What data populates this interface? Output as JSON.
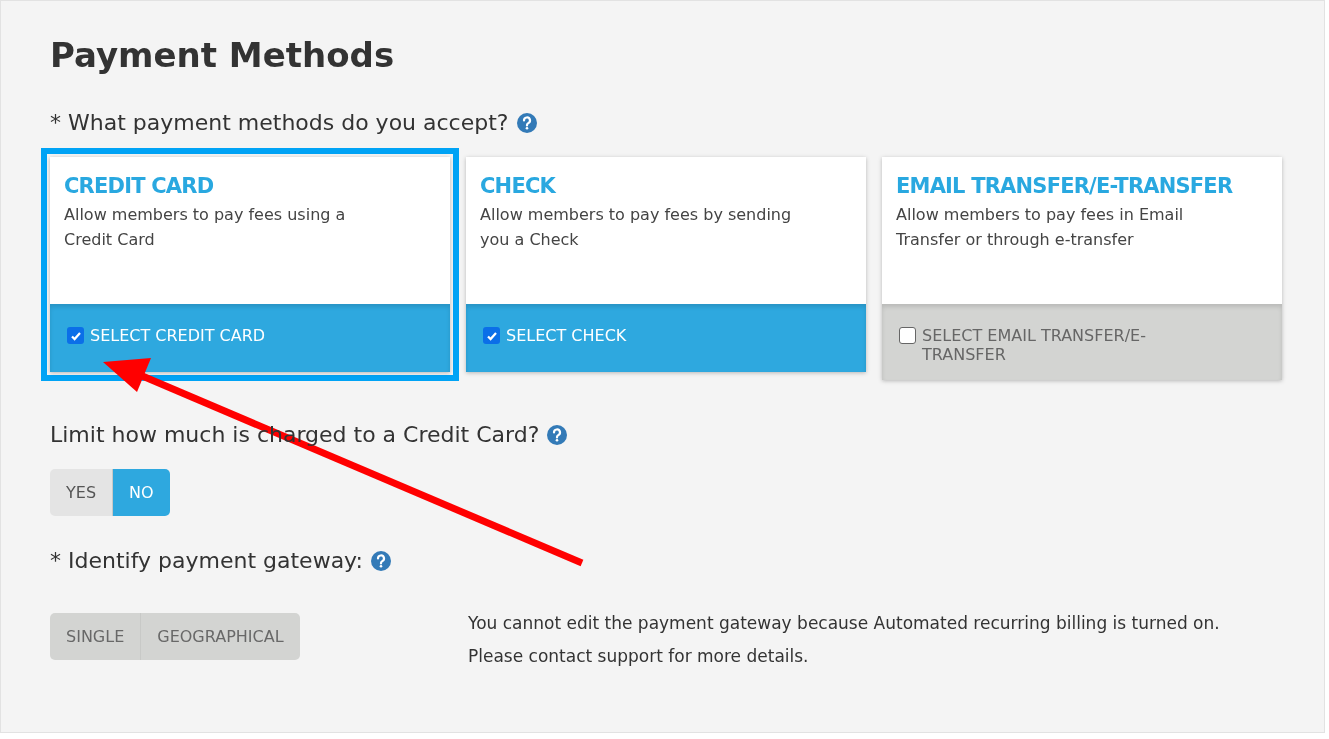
{
  "title": "Payment Methods",
  "methods_question": {
    "label": "* What payment methods do you accept?"
  },
  "methods": [
    {
      "title": "CREDIT CARD",
      "description": "Allow members to pay fees using a Credit Card",
      "select_label": "SELECT CREDIT CARD",
      "checked": true,
      "highlighted": true
    },
    {
      "title": "CHECK",
      "description": "Allow members to pay fees by sending you a Check",
      "select_label": "SELECT CHECK",
      "checked": true,
      "highlighted": false
    },
    {
      "title": "EMAIL TRANSFER/E-TRANSFER",
      "description": "Allow members to pay fees in Email Transfer or through e-transfer",
      "select_label": "SELECT EMAIL TRANSFER/E-TRANSFER",
      "checked": false,
      "highlighted": false
    }
  ],
  "limit_question": {
    "label": "Limit how much is charged to a Credit Card?"
  },
  "limit_options": [
    {
      "label": "YES",
      "selected": false
    },
    {
      "label": "NO",
      "selected": true
    }
  ],
  "gateway_question": {
    "label": "* Identify payment gateway:"
  },
  "gateway_options": [
    {
      "label": "SINGLE",
      "selected": false,
      "disabled": true
    },
    {
      "label": "GEOGRAPHICAL",
      "selected": false,
      "disabled": true
    }
  ],
  "gateway_note": "You cannot edit the payment gateway because Automated recurring billing is turned on. Please contact support for more details."
}
